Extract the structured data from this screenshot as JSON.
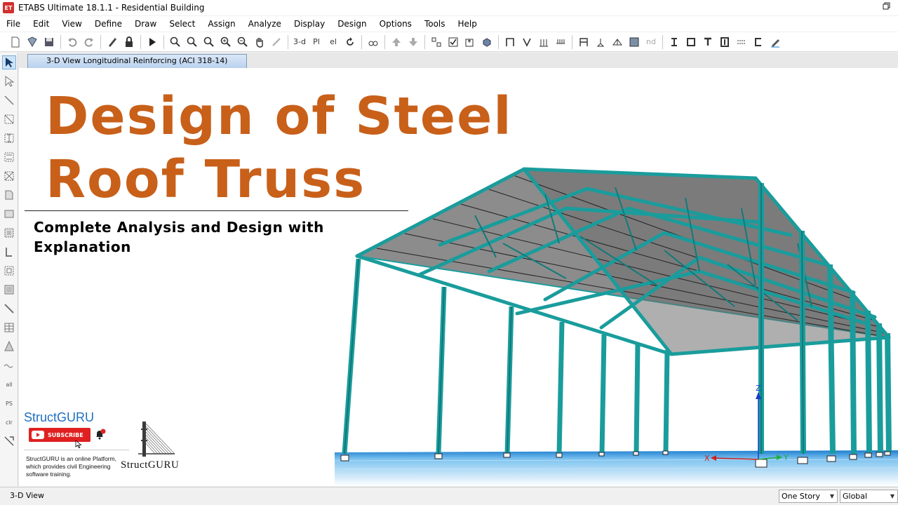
{
  "window": {
    "title": "ETABS Ultimate 18.1.1 - Residential Building",
    "app_icon_label": "ET"
  },
  "menu": [
    "File",
    "Edit",
    "View",
    "Define",
    "Draw",
    "Select",
    "Assign",
    "Analyze",
    "Display",
    "Design",
    "Options",
    "Tools",
    "Help"
  ],
  "toolbar": {
    "view_3d_label": "3-d",
    "plan_label": "Pl",
    "elev_label": "el",
    "nd_label": "nd"
  },
  "tab": {
    "label": "3-D View  Longitudinal Reinforcing  (ACI 318-14)"
  },
  "canvas": {
    "title_line1": "Design of Steel",
    "title_line2": "Roof Truss",
    "subtitle": "Complete Analysis and Design with Explanation",
    "brand_name": "StructGURU",
    "subscribe_label": "SUBSCRIBE",
    "brand_description": "StructGURU is an online Platform, which provides civil Engineering software training.",
    "logo_text": "StructGURU",
    "axis_x": "X",
    "axis_y": "Y",
    "axis_z": "Z"
  },
  "left_toolbar": {
    "all_label": "all",
    "ps_label": "PS",
    "clr_label": "clr"
  },
  "statusbar": {
    "view_name": "3-D View",
    "story_select": "One Story",
    "coord_select": "Global"
  },
  "colors": {
    "title_orange": "#c8601a",
    "truss_teal": "#1a9c9c",
    "roof_gray": "#8a8a8a",
    "brand_blue": "#1f6fc0",
    "subscribe_red": "#e02020"
  }
}
